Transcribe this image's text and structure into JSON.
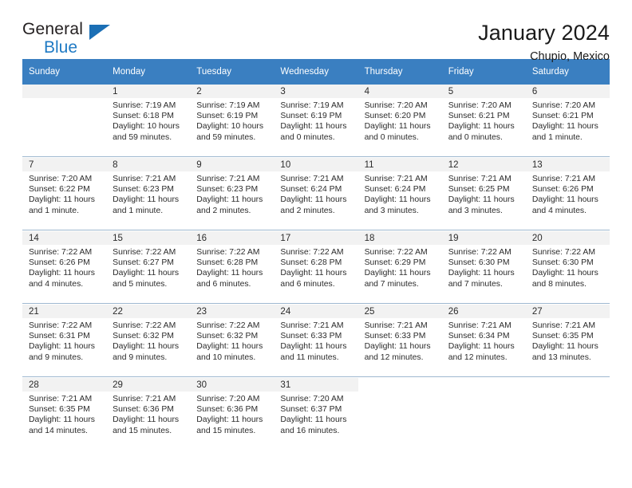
{
  "brand": {
    "word1": "General",
    "word2": "Blue",
    "triangle_color": "#1b6fb5"
  },
  "header": {
    "title": "January 2024",
    "subtitle": "Chupio, Mexico",
    "header_bg": "#3a7fc1",
    "daynum_bg": "#f2f2f2"
  },
  "weekday_headers": [
    "Sunday",
    "Monday",
    "Tuesday",
    "Wednesday",
    "Thursday",
    "Friday",
    "Saturday"
  ],
  "labels": {
    "sunrise_prefix": "Sunrise: ",
    "sunset_prefix": "Sunset: ",
    "daylight_prefix": "Daylight: "
  },
  "weeks": [
    [
      {
        "day": "",
        "sunrise": "",
        "sunset": "",
        "daylight": ""
      },
      {
        "day": "1",
        "sunrise": "Sunrise: 7:19 AM",
        "sunset": "Sunset: 6:18 PM",
        "daylight": "Daylight: 10 hours and 59 minutes."
      },
      {
        "day": "2",
        "sunrise": "Sunrise: 7:19 AM",
        "sunset": "Sunset: 6:19 PM",
        "daylight": "Daylight: 10 hours and 59 minutes."
      },
      {
        "day": "3",
        "sunrise": "Sunrise: 7:19 AM",
        "sunset": "Sunset: 6:19 PM",
        "daylight": "Daylight: 11 hours and 0 minutes."
      },
      {
        "day": "4",
        "sunrise": "Sunrise: 7:20 AM",
        "sunset": "Sunset: 6:20 PM",
        "daylight": "Daylight: 11 hours and 0 minutes."
      },
      {
        "day": "5",
        "sunrise": "Sunrise: 7:20 AM",
        "sunset": "Sunset: 6:21 PM",
        "daylight": "Daylight: 11 hours and 0 minutes."
      },
      {
        "day": "6",
        "sunrise": "Sunrise: 7:20 AM",
        "sunset": "Sunset: 6:21 PM",
        "daylight": "Daylight: 11 hours and 1 minute."
      }
    ],
    [
      {
        "day": "7",
        "sunrise": "Sunrise: 7:20 AM",
        "sunset": "Sunset: 6:22 PM",
        "daylight": "Daylight: 11 hours and 1 minute."
      },
      {
        "day": "8",
        "sunrise": "Sunrise: 7:21 AM",
        "sunset": "Sunset: 6:23 PM",
        "daylight": "Daylight: 11 hours and 1 minute."
      },
      {
        "day": "9",
        "sunrise": "Sunrise: 7:21 AM",
        "sunset": "Sunset: 6:23 PM",
        "daylight": "Daylight: 11 hours and 2 minutes."
      },
      {
        "day": "10",
        "sunrise": "Sunrise: 7:21 AM",
        "sunset": "Sunset: 6:24 PM",
        "daylight": "Daylight: 11 hours and 2 minutes."
      },
      {
        "day": "11",
        "sunrise": "Sunrise: 7:21 AM",
        "sunset": "Sunset: 6:24 PM",
        "daylight": "Daylight: 11 hours and 3 minutes."
      },
      {
        "day": "12",
        "sunrise": "Sunrise: 7:21 AM",
        "sunset": "Sunset: 6:25 PM",
        "daylight": "Daylight: 11 hours and 3 minutes."
      },
      {
        "day": "13",
        "sunrise": "Sunrise: 7:21 AM",
        "sunset": "Sunset: 6:26 PM",
        "daylight": "Daylight: 11 hours and 4 minutes."
      }
    ],
    [
      {
        "day": "14",
        "sunrise": "Sunrise: 7:22 AM",
        "sunset": "Sunset: 6:26 PM",
        "daylight": "Daylight: 11 hours and 4 minutes."
      },
      {
        "day": "15",
        "sunrise": "Sunrise: 7:22 AM",
        "sunset": "Sunset: 6:27 PM",
        "daylight": "Daylight: 11 hours and 5 minutes."
      },
      {
        "day": "16",
        "sunrise": "Sunrise: 7:22 AM",
        "sunset": "Sunset: 6:28 PM",
        "daylight": "Daylight: 11 hours and 6 minutes."
      },
      {
        "day": "17",
        "sunrise": "Sunrise: 7:22 AM",
        "sunset": "Sunset: 6:28 PM",
        "daylight": "Daylight: 11 hours and 6 minutes."
      },
      {
        "day": "18",
        "sunrise": "Sunrise: 7:22 AM",
        "sunset": "Sunset: 6:29 PM",
        "daylight": "Daylight: 11 hours and 7 minutes."
      },
      {
        "day": "19",
        "sunrise": "Sunrise: 7:22 AM",
        "sunset": "Sunset: 6:30 PM",
        "daylight": "Daylight: 11 hours and 7 minutes."
      },
      {
        "day": "20",
        "sunrise": "Sunrise: 7:22 AM",
        "sunset": "Sunset: 6:30 PM",
        "daylight": "Daylight: 11 hours and 8 minutes."
      }
    ],
    [
      {
        "day": "21",
        "sunrise": "Sunrise: 7:22 AM",
        "sunset": "Sunset: 6:31 PM",
        "daylight": "Daylight: 11 hours and 9 minutes."
      },
      {
        "day": "22",
        "sunrise": "Sunrise: 7:22 AM",
        "sunset": "Sunset: 6:32 PM",
        "daylight": "Daylight: 11 hours and 9 minutes."
      },
      {
        "day": "23",
        "sunrise": "Sunrise: 7:22 AM",
        "sunset": "Sunset: 6:32 PM",
        "daylight": "Daylight: 11 hours and 10 minutes."
      },
      {
        "day": "24",
        "sunrise": "Sunrise: 7:21 AM",
        "sunset": "Sunset: 6:33 PM",
        "daylight": "Daylight: 11 hours and 11 minutes."
      },
      {
        "day": "25",
        "sunrise": "Sunrise: 7:21 AM",
        "sunset": "Sunset: 6:33 PM",
        "daylight": "Daylight: 11 hours and 12 minutes."
      },
      {
        "day": "26",
        "sunrise": "Sunrise: 7:21 AM",
        "sunset": "Sunset: 6:34 PM",
        "daylight": "Daylight: 11 hours and 12 minutes."
      },
      {
        "day": "27",
        "sunrise": "Sunrise: 7:21 AM",
        "sunset": "Sunset: 6:35 PM",
        "daylight": "Daylight: 11 hours and 13 minutes."
      }
    ],
    [
      {
        "day": "28",
        "sunrise": "Sunrise: 7:21 AM",
        "sunset": "Sunset: 6:35 PM",
        "daylight": "Daylight: 11 hours and 14 minutes."
      },
      {
        "day": "29",
        "sunrise": "Sunrise: 7:21 AM",
        "sunset": "Sunset: 6:36 PM",
        "daylight": "Daylight: 11 hours and 15 minutes."
      },
      {
        "day": "30",
        "sunrise": "Sunrise: 7:20 AM",
        "sunset": "Sunset: 6:36 PM",
        "daylight": "Daylight: 11 hours and 15 minutes."
      },
      {
        "day": "31",
        "sunrise": "Sunrise: 7:20 AM",
        "sunset": "Sunset: 6:37 PM",
        "daylight": "Daylight: 11 hours and 16 minutes."
      },
      {
        "day": "",
        "sunrise": "",
        "sunset": "",
        "daylight": ""
      },
      {
        "day": "",
        "sunrise": "",
        "sunset": "",
        "daylight": ""
      },
      {
        "day": "",
        "sunrise": "",
        "sunset": "",
        "daylight": ""
      }
    ]
  ]
}
